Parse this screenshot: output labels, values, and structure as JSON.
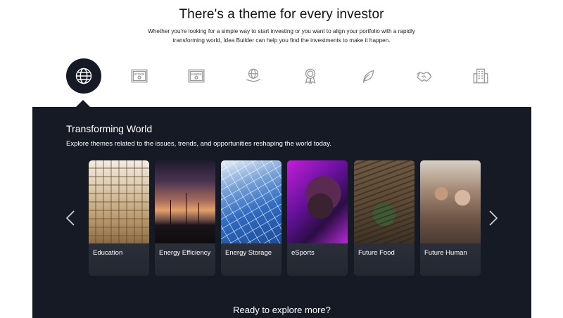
{
  "hero": {
    "title": "There's a theme for every investor",
    "subtitle": "Whether you're looking for a simple way to start investing or you want to align your portfolio with a rapidly transforming world, Idea Builder can help you find the investments to make it happen."
  },
  "theme_icons": [
    {
      "name": "globe-icon",
      "active": true
    },
    {
      "name": "stock-icon",
      "text": "STOCK"
    },
    {
      "name": "funds-icon",
      "text": "FUNDS"
    },
    {
      "name": "globe-hand-icon"
    },
    {
      "name": "award-ribbon-icon"
    },
    {
      "name": "leaf-icon"
    },
    {
      "name": "handshake-icon"
    },
    {
      "name": "building-icon"
    }
  ],
  "panel": {
    "title": "Transforming World",
    "description": "Explore themes related to the issues, trends, and opportunities reshaping the world today.",
    "cta": "Ready to explore more?"
  },
  "cards": [
    {
      "label": "Education"
    },
    {
      "label": "Energy Efficiency"
    },
    {
      "label": "Energy Storage"
    },
    {
      "label": "eSports"
    },
    {
      "label": "Future Food"
    },
    {
      "label": "Future Human"
    }
  ],
  "colors": {
    "panel_bg": "#161a24",
    "active_icon_bg": "#161a24",
    "inactive_icon": "#9a9a9a",
    "text_on_dark": "#ffffff"
  }
}
